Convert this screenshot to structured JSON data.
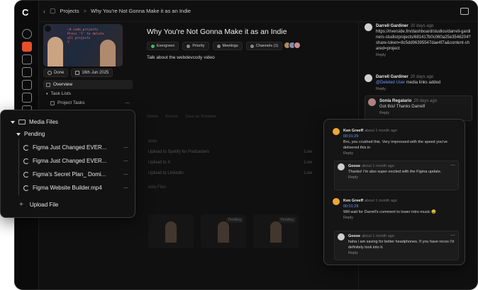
{
  "topbar": {
    "breadcrumb_parent": "Projects",
    "breadcrumb_sep": ">",
    "breadcrumb_current": "Why You're Not Gonna Make it as an Indie"
  },
  "thumbnail": {
    "code_lines": [
      "~d code_projects",
      "Press 'Y' to delete",
      "all projects",
      "Y"
    ]
  },
  "project": {
    "status": "Done",
    "date": "16th Jun 2025",
    "title": "Why You're Not Gonna Make it as an Indie",
    "tags": [
      "Evergreen",
      "Priority",
      "Meetings",
      "Channels (1)"
    ],
    "description": "Talk about the webdevcody video"
  },
  "left_menu": {
    "items": [
      "Overview",
      "Task Lists",
      "Project Tasks"
    ]
  },
  "actions": [
    "Delete",
    "Archive",
    "Save as Template"
  ],
  "tasks": {
    "section_label": "asks",
    "items": [
      {
        "label": "Upload to Spotify for Podcasters",
        "priority": "Low"
      },
      {
        "label": "Upload to X",
        "priority": "Low"
      },
      {
        "label": "Upload to Linkedin",
        "priority": "Low"
      }
    ],
    "media_label": "edia Files",
    "tile_badge": "Pending"
  },
  "comments": [
    {
      "author": "Darrell Gardiner",
      "time": "20 days ago",
      "text": "https://riverside.fm/dashboard/studios/darrell-gardiners-studio/projects/681417b0c060a25e3546204?share-token=8c5dd96395547dae4f7a&content-shared=project",
      "reply": "Reply"
    },
    {
      "author": "Darrell Gardiner",
      "time": "20 days ago",
      "mention": "@Deleted User",
      "text": " media links added",
      "reply": "Reply"
    },
    {
      "author": "Sonia Regalario",
      "time": "20 days ago",
      "text": "Got this! Thanks Darrell!",
      "reply": "Reply"
    }
  ],
  "media_popup": {
    "title": "Media Files",
    "group": "Pending",
    "files": [
      "Figma Just Changed EVER...",
      "Figma Just Changed EVER...",
      "Figma's Secret Plan_ Domi...",
      "Figma Website Builder.mp4"
    ],
    "upload": "Upload File"
  },
  "comment_popup": {
    "threads": [
      {
        "author": "Ken Greeff",
        "time": "about 1 month ago",
        "timestamp": "00:01:29",
        "text": "Bro, you crushed this. Very impressed with the speed you've delivered this in",
        "reply": "Reply",
        "nested": {
          "author": "Goose",
          "time": "about 1 month ago",
          "text": "Thanks! I'm also super excited with the Figma update.",
          "reply": "Reply"
        }
      },
      {
        "author": "Ken Greeff",
        "time": "about 1 month ago",
        "timestamp": "00:01:29",
        "text": "Will wait for Darrell's comment to lower intro music 😅",
        "reply": "Reply",
        "nested": {
          "author": "Goose",
          "time": "about 1 month ago",
          "text": "haha i am saving for better headphones. If you have recos I'd definitely look into it.",
          "reply": "Reply"
        }
      }
    ]
  },
  "colors": {
    "accent": "#e8502a",
    "link": "#6f98ff",
    "background": "#101010"
  }
}
